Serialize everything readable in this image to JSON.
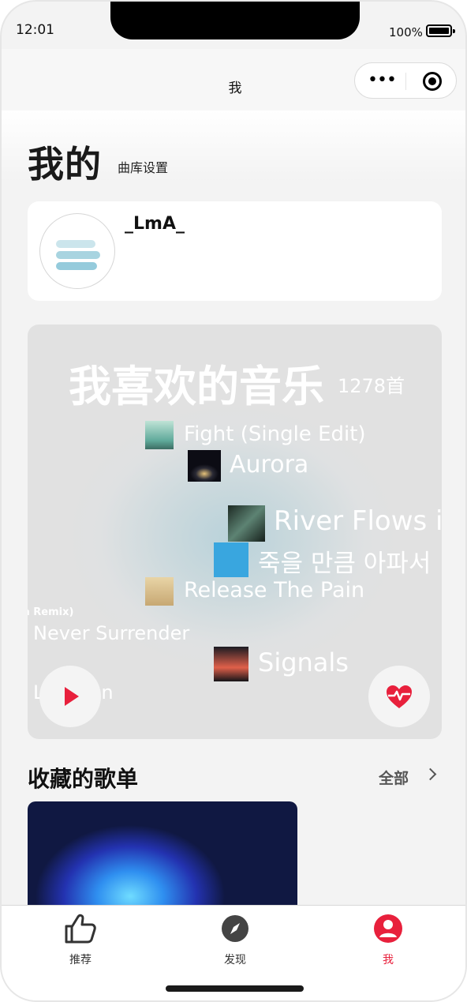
{
  "status_bar": {
    "time": "12:01",
    "battery": "100%"
  },
  "nav": {
    "title": "我"
  },
  "header": {
    "title": "我的",
    "settings_link": "曲库设置"
  },
  "profile": {
    "username": "_LmA_"
  },
  "liked": {
    "title": "我喜欢的音乐",
    "count": "1278首",
    "songs": [
      "Fight (Single Edit)",
      "Aurora",
      "River Flows i",
      "죽을 만큼 아파서",
      "Release The Pain",
      "a Remix)",
      "Never Surrender",
      "Signals",
      "Light On"
    ]
  },
  "playlists": {
    "title": "收藏的歌单",
    "all_label": "全部"
  },
  "tabs": [
    {
      "label": "推荐",
      "icon": "thumbs-up-icon"
    },
    {
      "label": "发现",
      "icon": "compass-icon"
    },
    {
      "label": "我",
      "icon": "user-icon",
      "active": true
    }
  ],
  "colors": {
    "accent": "#e8203c",
    "background": "#f3f3f3"
  }
}
